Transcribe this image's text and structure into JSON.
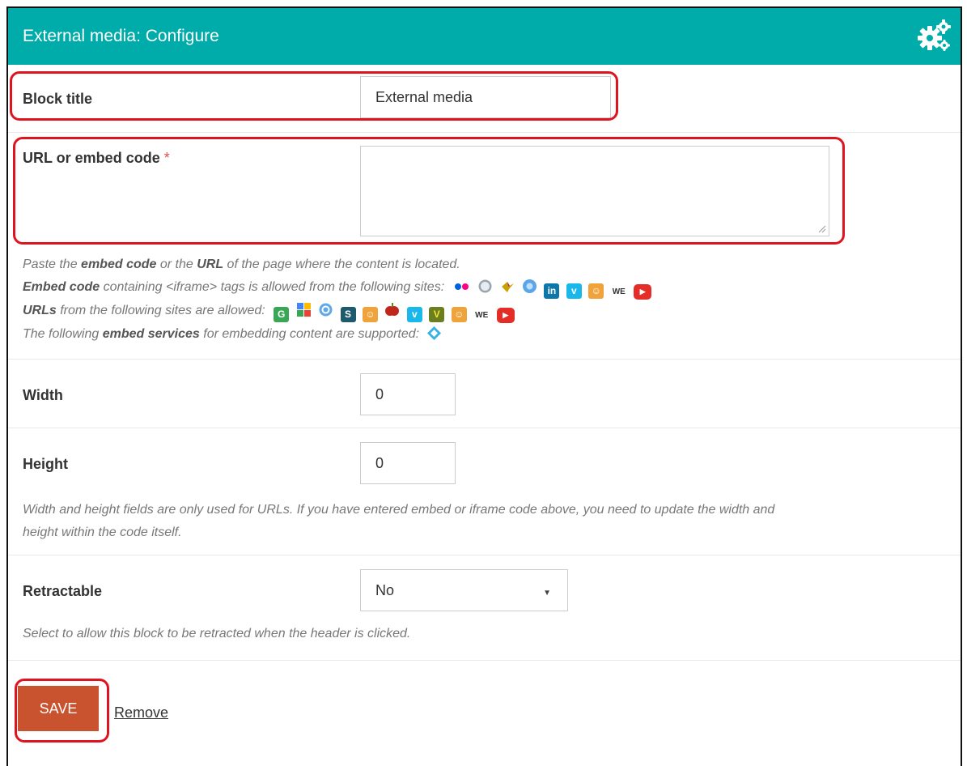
{
  "header": {
    "title": "External media: Configure",
    "icon": "gears-icon"
  },
  "block_title": {
    "label": "Block title",
    "value": "External media"
  },
  "url": {
    "label": "URL or embed code",
    "required_mark": "*",
    "value": "",
    "help": {
      "line1_pre": "Paste the ",
      "line1_b1": "embed code",
      "line1_mid": " or the ",
      "line1_b2": "URL",
      "line1_post": " of the page where the content is located.",
      "line2_b": "Embed code",
      "line2_post": " containing <iframe> tags is allowed from the following sites:",
      "line3_b": "URLs",
      "line3_post": " from the following sites are allowed:",
      "line4_pre": "The following ",
      "line4_b": "embed services",
      "line4_post": " for embedding content are supported:"
    }
  },
  "width": {
    "label": "Width",
    "value": "0"
  },
  "height": {
    "label": "Height",
    "value": "0",
    "help": "Width and height fields are only used for URLs. If you have entered embed or iframe code above, you need to update the width and height within the code itself."
  },
  "retractable": {
    "label": "Retractable",
    "value": "No",
    "help": "Select to allow this block to be retracted when the header is clicked."
  },
  "actions": {
    "save": "SAVE",
    "remove": "Remove"
  },
  "colors": {
    "header": "#00aca9",
    "save": "#c9532e",
    "highlight": "#e0141e"
  }
}
